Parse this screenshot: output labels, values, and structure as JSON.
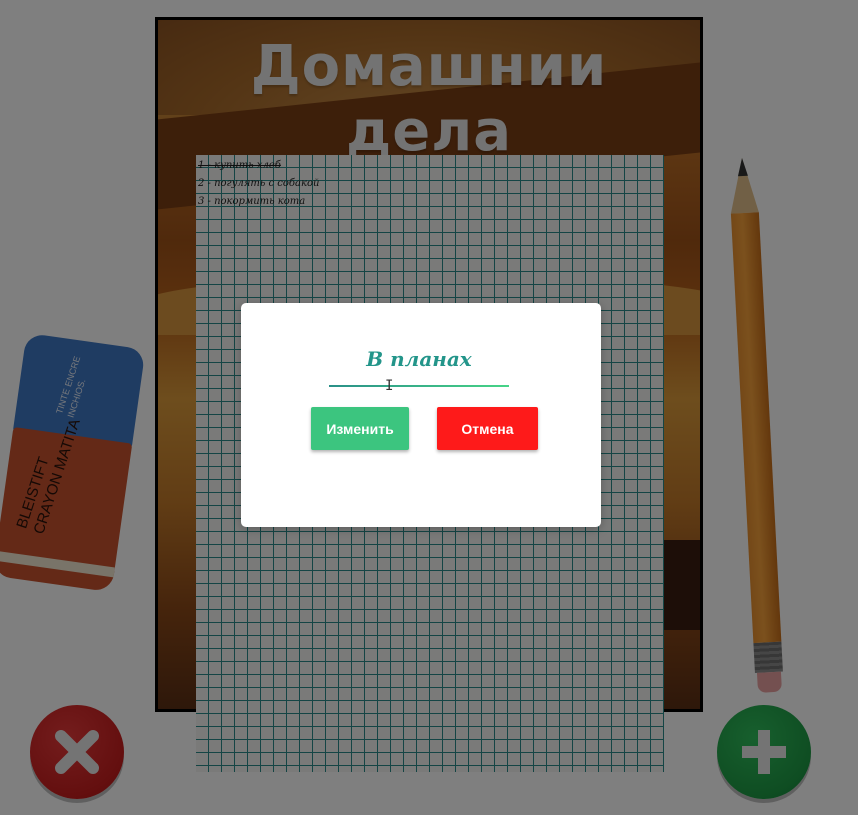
{
  "page": {
    "title": "Домашнии дела"
  },
  "tasks": [
    {
      "text": "1 - купить хлеб",
      "done": true
    },
    {
      "text": "2 - погулять с собакой",
      "done": false
    },
    {
      "text": "3 - покормить кота",
      "done": false
    }
  ],
  "eraser": {
    "blue_text": "TINTE ENCRE INCHIOS.",
    "red_text": "BLEISTIFT CRAYON MATITA"
  },
  "modal": {
    "input_value": "В планах",
    "change_label": "Изменить",
    "cancel_label": "Отмена"
  },
  "colors": {
    "change_button": "#3cc57f",
    "cancel_button": "#fe1a1a",
    "accent": "#23958a",
    "delete_button": "#c81e1e",
    "add_button": "#1e9b45"
  },
  "icons": {
    "delete": "close-icon",
    "add": "plus-icon"
  }
}
